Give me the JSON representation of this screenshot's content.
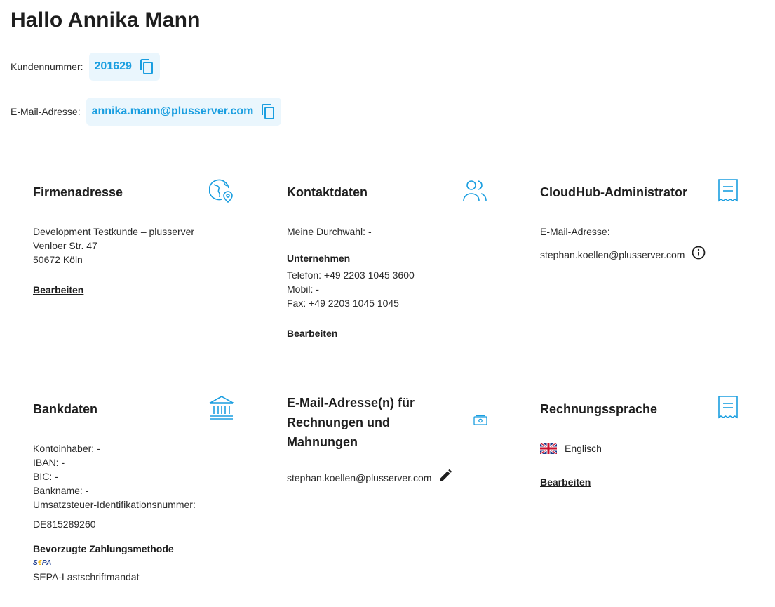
{
  "header": {
    "greeting": "Hallo Annika Mann",
    "customer_number_label": "Kundennummer:",
    "customer_number": "201629",
    "email_label": "E-Mail-Adresse:",
    "email": "annika.mann@plusserver.com"
  },
  "firmenadresse": {
    "title": "Firmenadresse",
    "icon": "globe-pin-icon",
    "lines": [
      "Development Testkunde – plusserver",
      "Venloer Str. 47",
      "50672 Köln"
    ],
    "edit": "Bearbeiten"
  },
  "kontaktdaten": {
    "title": "Kontaktdaten",
    "icon": "users-icon",
    "durchwahl": "Meine Durchwahl:  -",
    "company_heading": "Unternehmen",
    "telefon": "Telefon:  +49 2203 1045 3600",
    "mobil": "Mobil:  -",
    "fax": "Fax:  +49 2203 1045 1045",
    "edit": "Bearbeiten"
  },
  "cloudhub": {
    "title": "CloudHub-Administrator",
    "icon": "receipt-icon",
    "email_label": "E-Mail-Adresse:",
    "email": "stephan.koellen@plusserver.com"
  },
  "bankdaten": {
    "title": "Bankdaten",
    "icon": "bank-icon",
    "kontoinhaber": "Kontoinhaber:  -",
    "iban": "IBAN:  -",
    "bic": "BIC:  -",
    "bankname": "Bankname:  -",
    "ust_label": "Umsatzsteuer-Identifikationsnummer:",
    "ust_value": "DE815289260",
    "payment_heading": "Bevorzugte Zahlungsmethode",
    "sepa_logo": "SEPA",
    "payment_method": "SEPA-Lastschriftmandat"
  },
  "rechnung_email": {
    "title": "E-Mail-Adresse(n) für Rechnungen und Mahnungen",
    "icon": "money-icon",
    "email": "stephan.koellen@plusserver.com"
  },
  "rechnungssprache": {
    "title": "Rechnungssprache",
    "icon": "receipt-icon",
    "language": "Englisch",
    "edit": "Bearbeiten"
  },
  "colors": {
    "accent": "#1a9ee0",
    "chip_bg": "#eaf6fd",
    "text": "#1e1e1e"
  }
}
